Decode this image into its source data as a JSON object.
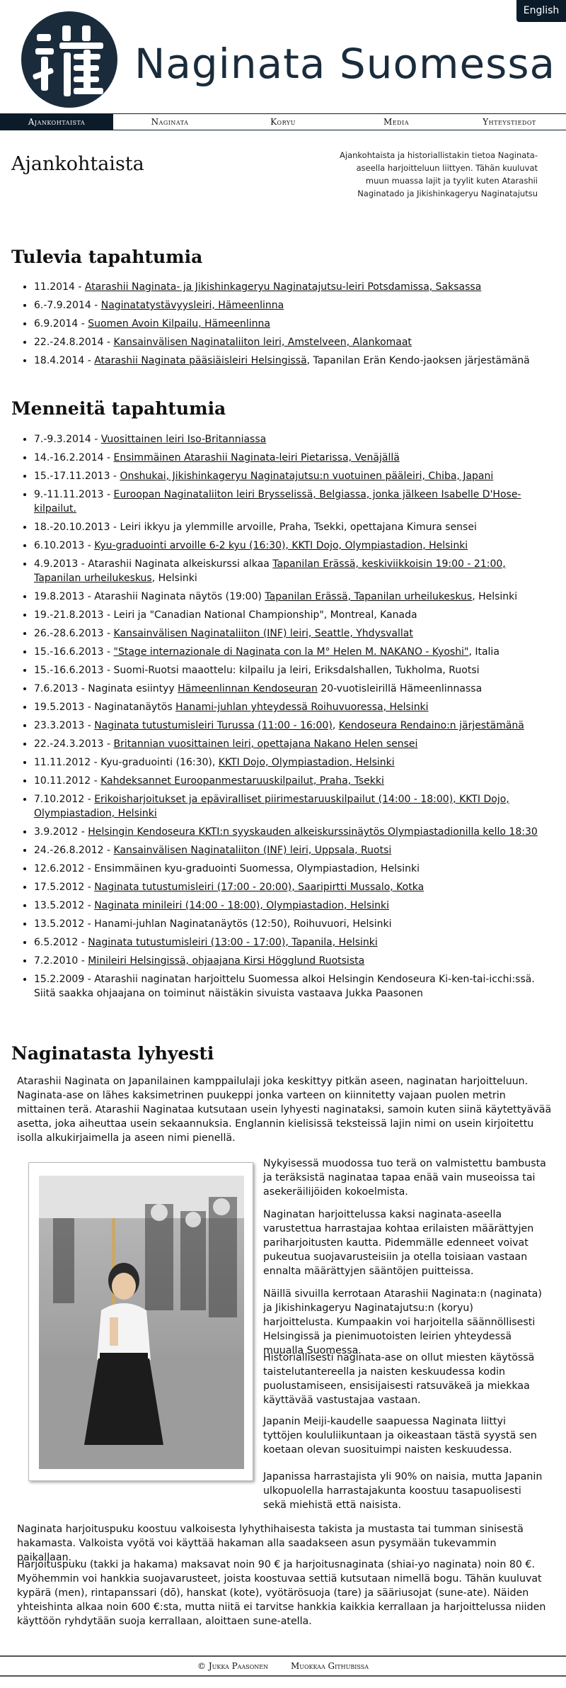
{
  "header": {
    "site_title": "Naginata Suomessa",
    "lang_button": "English"
  },
  "nav": [
    {
      "label": "Ajankohtaista"
    },
    {
      "label": "Naginata"
    },
    {
      "label": "Koryu"
    },
    {
      "label": "Media"
    },
    {
      "label": "Yhteystiedot"
    }
  ],
  "page": {
    "title": "Ajankohtaista",
    "intro": "Ajankohtaista ja historiallistakin tietoa Naginata-aseella harjoitteluun liittyen. Tähän kuuluvat muun muassa lajit ja tyylit kuten Atarashii Naginatado ja Jikishinkageryu Naginatajutsu"
  },
  "upcoming": {
    "heading": "Tulevia tapahtumia",
    "items": [
      {
        "date": "11.2014 - ",
        "link": "Atarashii Naginata- ja Jikishinkageryu Naginatajutsu-leiri Potsdamissa, Saksassa",
        "after": ""
      },
      {
        "date": "6.-7.9.2014 - ",
        "link": "Naginatatystävyysleiri, Hämeenlinna",
        "after": ""
      },
      {
        "date": "6.9.2014 - ",
        "link": "Suomen Avoin Kilpailu, Hämeenlinna",
        "after": ""
      },
      {
        "date": "22.-24.8.2014 - ",
        "link": "Kansainvälisen Naginataliiton leiri, Amstelveen, Alankomaat",
        "after": ""
      },
      {
        "date": "18.4.2014 - ",
        "link": "Atarashii Naginata pääsiäisleiri Helsingissä",
        "after": ", Tapanilan Erän Kendo-jaoksen järjestämänä"
      }
    ]
  },
  "past": {
    "heading": "Menneitä tapahtumia",
    "items": [
      {
        "date": "7.-9.3.2014 - ",
        "link": "Vuosittainen leiri Iso-Britanniassa",
        "after": ""
      },
      {
        "date": "14.-16.2.2014 - ",
        "link": "Ensimmäinen Atarashii Naginata-leiri Pietarissa, Venäjällä",
        "after": ""
      },
      {
        "date": "15.-17.11.2013 - ",
        "link": "Onshukai, Jikishinkageryu Naginatajutsu:n vuotuinen pääleiri, Chiba, Japani",
        "after": ""
      },
      {
        "date": "9.-11.11.2013 - ",
        "link": "Euroopan Naginataliiton leiri Brysselissä, Belgiassa, jonka jälkeen Isabelle D'Hose-kilpailut.",
        "after": ""
      },
      {
        "date": "18.-20.10.2013 - ",
        "link": "",
        "after": "Leiri ikkyu ja ylemmille arvoille, Praha, Tsekki, opettajana Kimura sensei"
      },
      {
        "date": "6.10.2013 - ",
        "link": "Kyu-graduointi arvoille 6-2 kyu (16:30), KKTI Dojo, Olympiastadion, Helsinki",
        "after": ""
      },
      {
        "date": "4.9.2013 - Atarashii Naginata alkeiskurssi alkaa ",
        "link": "Tapanilan Erässä, keskiviikkoisin 19:00 - 21:00, Tapanilan urheilukeskus",
        "after": ", Helsinki"
      },
      {
        "date": "19.8.2013 - Atarashii Naginata näytös (19:00) ",
        "link": "Tapanilan Erässä, Tapanilan urheilukeskus",
        "after": ", Helsinki"
      },
      {
        "date": "19.-21.8.2013 - ",
        "link": "",
        "after": "Leiri ja \"Canadian National Championship\", Montreal, Kanada"
      },
      {
        "date": "26.-28.6.2013 - ",
        "link": "Kansainvälisen Naginataliiton (INF) leiri, Seattle, Yhdysvallat",
        "after": ""
      },
      {
        "date": "15.-16.6.2013 - ",
        "link": "\"Stage internazionale di Naginata con la M° Helen M. NAKANO - Kyoshi\"",
        "after": ", Italia"
      },
      {
        "date": "15.-16.6.2013 - ",
        "link": "",
        "after": "Suomi-Ruotsi maaottelu: kilpailu ja leiri, Eriksdalshallen, Tukholma, Ruotsi"
      },
      {
        "date": "7.6.2013 - Naginata esiintyy ",
        "link": "Hämeenlinnan Kendoseuran",
        "after": " 20-vuotisleirillä Hämeenlinnassa"
      },
      {
        "date": "19.5.2013 - Naginatanäytös ",
        "link": "Hanami-juhlan yhteydessä Roihuvuoressa, Helsinki",
        "after": ""
      },
      {
        "date": "23.3.2013 - ",
        "link": "Naginata tutustumisleiri Turussa (11:00 - 16:00)",
        "after": ", ",
        "link2": "Kendoseura Rendaino:n järjestämänä"
      },
      {
        "date": "22.-24.3.2013 - ",
        "link": "Britannian vuosittainen leiri, opettajana Nakano Helen sensei",
        "after": ""
      },
      {
        "date": "11.11.2012 - Kyu-graduointi (16:30), ",
        "link": "KKTI Dojo, Olympiastadion, Helsinki",
        "after": ""
      },
      {
        "date": "10.11.2012 - ",
        "link": "Kahdeksannet Euroopanmestaruuskilpailut, Praha, Tsekki",
        "after": ""
      },
      {
        "date": "7.10.2012 - ",
        "link": "Erikoisharjoitukset ja epäviralliset piirimestaruuskilpailut (14:00 - 18:00), KKTI Dojo, Olympiastadion, Helsinki",
        "after": ""
      },
      {
        "date": "3.9.2012 - ",
        "link": "Helsingin Kendoseura KKTI:n syyskauden alkeiskurssinäytös Olympiastadionilla kello 18:30",
        "after": ""
      },
      {
        "date": "24.-26.8.2012 - ",
        "link": "Kansainvälisen Naginataliiton (INF) leiri, Uppsala, Ruotsi",
        "after": ""
      },
      {
        "date": "12.6.2012 - ",
        "link": "",
        "after": "Ensimmäinen kyu-graduointi Suomessa, Olympiastadion, Helsinki"
      },
      {
        "date": "17.5.2012 - ",
        "link": "Naginata tutustumisleiri (17:00 - 20:00), Saaripirtti Mussalo, Kotka",
        "after": ""
      },
      {
        "date": "13.5.2012 - ",
        "link": "Naginata minileiri (14:00 - 18:00), Olympiastadion, Helsinki",
        "after": ""
      },
      {
        "date": "13.5.2012 - ",
        "link": "",
        "after": "Hanami-juhlan Naginatanäytös (12:50), Roihuvuori, Helsinki"
      },
      {
        "date": "6.5.2012 - ",
        "link": "Naginata tutustumisleiri (13:00 - 17:00), Tapanila, Helsinki",
        "after": ""
      },
      {
        "date": "7.2.2010 - ",
        "link": "Minileiri Helsingissä, ohjaajana Kirsi Högglund Ruotsista",
        "after": ""
      },
      {
        "date": "15.2.2009 - ",
        "link": "",
        "after": "Atarashii naginatan harjoittelu Suomessa alkoi Helsingin Kendoseura Ki-ken-tai-icchi:ssä. Siitä saakka ohjaajana on toiminut näistäkin sivuista vastaava Jukka Paasonen"
      }
    ]
  },
  "about": {
    "heading": "Naginatasta lyhyesti",
    "p1": "Atarashii Naginata on Japanilainen kamppailulaji joka keskittyy pitkän aseen, naginatan harjoitteluun. Naginata-ase on lähes kaksimetrinen puukeppi jonka varteen on kiinnitetty vajaan puolen metrin mittainen terä. Atarashii Naginataa kutsutaan usein lyhyesti naginataksi, samoin kuten siinä käytettyävää asetta, joka aiheuttaa usein sekaannuksia. Englannin kielisissä teksteissä lajin nimi on usein kirjoitettu isolla alkukirjaimella ja aseen nimi pienellä.",
    "p2": "Nykyisessä muodossa tuo terä on valmistettu bambusta ja teräksistä naginataa tapaa enää vain museoissa tai asekeräilijöiden kokoelmista.",
    "p3": "Naginatan harjoittelussa kaksi naginata-aseella varustettua harrastajaa kohtaa erilaisten määrättyjen pariharjoitusten kautta. Pidemmälle edenneet voivat pukeutua suojavarusteisiin ja otella toisiaan vastaan ennalta määrättyjen sääntöjen puitteissa.",
    "p4": "Näillä sivuilla kerrotaan Atarashii Naginata:n (naginata) ja Jikishinkageryu Naginatajutsu:n (koryu) harjoittelusta. Kumpaakin voi harjoitella säännöllisesti Helsingissä ja pienimuotoisten leirien yhteydessä muualla Suomessa.",
    "p5": "Historiallisesti naginata-ase on ollut miesten käytössä taistelutantereella ja naisten keskuudessa kodin puolustamiseen, ensisijaisesti ratsuväkeä ja miekkaa käyttävää vastustajaa vastaan.",
    "p6": "Japanin Meiji-kaudelle saapuessa Naginata liittyi tyttöjen koululiikuntaan ja oikeastaan tästä syystä sen koetaan olevan suosituimpi naisten keskuudessa.",
    "p7": "Japanissa harrastajista yli 90% on naisia, mutta Japanin ulkopuolella harrastajakunta koostuu tasapuolisesti sekä miehistä että naisista.",
    "p8": "Naginata harjoituspuku koostuu valkoisesta lyhythihaisesta takista ja mustasta tai tumman sinisestä hakamasta. Valkoista vyötä voi käyttää hakaman alla saadakseen asun pysymään tukevammin paikallaan.",
    "p9": "Harjoituspuku (takki ja hakama) maksavat noin 90 € ja harjoitusnaginata (shiai-yo naginata) noin 80 €. Myöhemmin voi hankkia suojavarusteet, joista koostuvaa settiä kutsutaan nimellä bogu. Tähän kuuluvat kypärä (men), rintapanssari (dō), hanskat (kote), vyötärösuoja (tare) ja sääriusojat (sune-ate). Näiden yhteishinta alkaa noin 600 €:sta, mutta niitä ei tarvitse hankkia kaikkia kerrallaan ja harjoittelussa niiden käyttöön ryhdytään suoja kerrallaan, aloittaen sune-atella."
  },
  "footer": {
    "author": "© Jukka Paasonen",
    "edit": "Muokkaa Githubissa"
  },
  "colors": {
    "navy": "#0c1b2a",
    "title": "#1a2c3c"
  }
}
